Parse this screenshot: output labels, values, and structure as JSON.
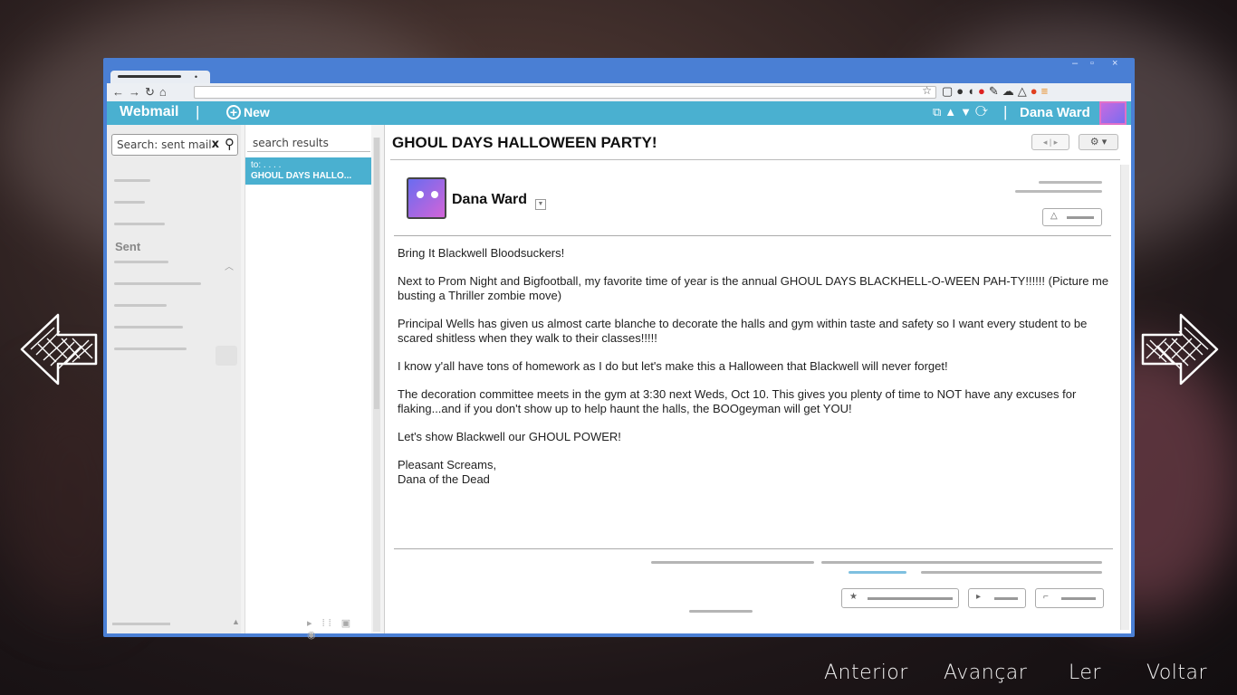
{
  "browser": {
    "window_controls": {
      "minimize": "–",
      "restore": "▫",
      "close": "×"
    }
  },
  "header": {
    "brand": "Webmail",
    "separator": "|",
    "new_label": "New",
    "user_name": "Dana Ward"
  },
  "sidebar": {
    "search_value": "Search: sent mail",
    "clear_label": "x",
    "folder_label": "Sent"
  },
  "results": {
    "header": "search results",
    "items": [
      {
        "to": "to: . . . .",
        "subject": "GHOUL DAYS HALLO..."
      }
    ]
  },
  "message": {
    "subject": "GHOUL DAYS HALLOWEEN PARTY!",
    "sender": "Dana Ward",
    "body": [
      "Bring It Blackwell Bloodsuckers!",
      "Next to Prom Night and Bigfootball, my favorite time of year is the annual GHOUL DAYS BLACKHELL-O-WEEN PAH-TY!!!!!! (Picture me busting a Thriller zombie move)",
      "Principal Wells has given us almost carte blanche to decorate the halls and gym within taste and safety so I want every student to be scared shitless when they walk to their classes!!!!!",
      "I know y'all have tons of homework as I do but let's make this a Halloween that Blackwell will never forget!",
      "The decoration committee meets in the gym at 3:30 next Weds, Oct 10. This gives you plenty of time to NOT have any excuses for flaking...and if you don't show up to help haunt the halls, the BOOgeyman will get YOU!",
      "Let's show Blackwell our GHOUL POWER!",
      "Pleasant Screams,\nDana of the Dead"
    ]
  },
  "game_menu": {
    "previous": "Anterior",
    "forward": "Avançar",
    "read": "Ler",
    "back": "Voltar"
  },
  "colors": {
    "window_frame": "#4a7fd4",
    "app_header": "#4ab0d0",
    "selected_result": "#4ab0d0"
  },
  "icons": [
    "back-icon",
    "forward-icon",
    "reload-icon",
    "home-icon",
    "bookmark-star-icon",
    "new-plus-icon",
    "refresh-icon",
    "search-icon",
    "gear-icon",
    "arrow-left-icon",
    "arrow-right-icon"
  ]
}
